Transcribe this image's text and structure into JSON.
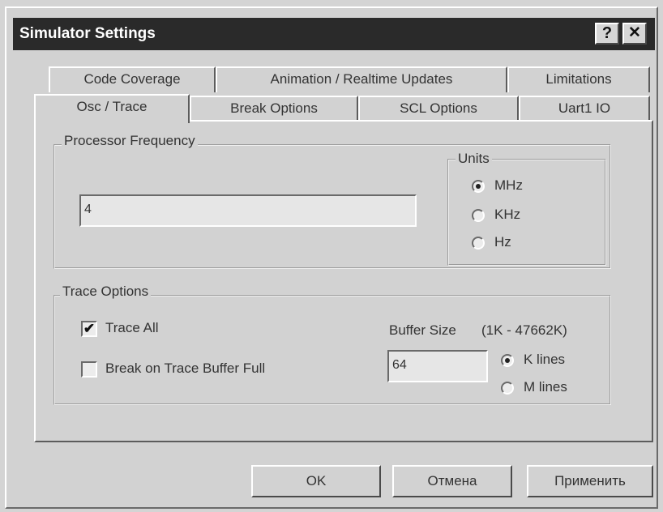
{
  "window": {
    "title": "Simulator Settings",
    "help_button": "?",
    "close_button": "✕"
  },
  "tabs": {
    "row1": [
      "Code Coverage",
      "Animation / Realtime Updates",
      "Limitations"
    ],
    "row2": [
      "Osc / Trace",
      "Break Options",
      "SCL Options",
      "Uart1 IO"
    ],
    "active": "Osc / Trace"
  },
  "processor_frequency": {
    "group_label": "Processor Frequency",
    "value": "4",
    "units": {
      "label": "Units",
      "options": [
        "MHz",
        "KHz",
        "Hz"
      ],
      "selected": "MHz"
    }
  },
  "trace_options": {
    "group_label": "Trace Options",
    "trace_all_label": "Trace All",
    "trace_all_checked": true,
    "break_on_full_label": "Break on Trace Buffer Full",
    "break_on_full_checked": false,
    "buffer_size_label": "Buffer Size",
    "buffer_size_range": "(1K - 47662K)",
    "buffer_size_value": "64",
    "unit_options": [
      "K lines",
      "M lines"
    ],
    "unit_selected": "K lines"
  },
  "buttons": {
    "ok": "OK",
    "cancel": "Отмена",
    "apply": "Применить"
  }
}
